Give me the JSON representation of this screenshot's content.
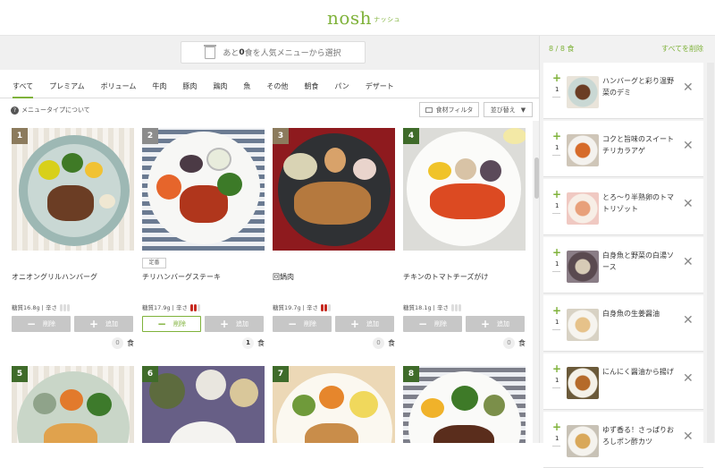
{
  "header": {
    "logo": "nosh",
    "logo_sub": "ナッシュ"
  },
  "search": {
    "prefix": "あと",
    "count": "0",
    "suffix": "食を人気メニューから選択"
  },
  "tabs": [
    "すべて",
    "プレミアム",
    "ボリューム",
    "牛肉",
    "豚肉",
    "鶏肉",
    "魚",
    "その他",
    "朝食",
    "パン",
    "デザート"
  ],
  "filter": {
    "type_info": "メニュータイプについて",
    "filter_btn": "食材フィルタ",
    "sort_btn": "並び替え"
  },
  "cards": [
    {
      "num": "1",
      "name": "オニオングリルハンバーグ",
      "badge": "",
      "carb": "糖質16.8g",
      "spicy_label": "辛さ",
      "minus": "削除",
      "plus": "追加",
      "qty": "0",
      "unit": "食"
    },
    {
      "num": "2",
      "name": "チリハンバーグステーキ",
      "badge": "定番",
      "carb": "糖質17.9g",
      "spicy_label": "辛さ",
      "minus": "削除",
      "plus": "追加",
      "qty": "1",
      "unit": "食"
    },
    {
      "num": "3",
      "name": "回鍋肉",
      "badge": "",
      "carb": "糖質19.7g",
      "spicy_label": "辛さ",
      "minus": "削除",
      "plus": "追加",
      "qty": "0",
      "unit": "食"
    },
    {
      "num": "4",
      "name": "チキンのトマトチーズがけ",
      "badge": "",
      "carb": "糖質18.1g",
      "spicy_label": "辛さ",
      "minus": "削除",
      "plus": "追加",
      "qty": "0",
      "unit": "食"
    },
    {
      "num": "5"
    },
    {
      "num": "6"
    },
    {
      "num": "7"
    },
    {
      "num": "8"
    }
  ],
  "sidebar": {
    "count": "8 / 8 食",
    "clear_all": "すべてを削除",
    "items": [
      {
        "qty": "1",
        "name": "ハンバーグと彩り温野菜のデミ"
      },
      {
        "qty": "1",
        "name": "コクと旨味のスイートチリカラアゲ"
      },
      {
        "qty": "1",
        "name": "とろ〜り半熟卵のトマトリゾット"
      },
      {
        "qty": "1",
        "name": "白身魚と野菜の白湯ソース"
      },
      {
        "qty": "1",
        "name": "白身魚の生姜醤油"
      },
      {
        "qty": "1",
        "name": "にんにく醤油から揚げ"
      },
      {
        "qty": "1",
        "name": "ゆず香る！さっぱりおろしポン酢カツ"
      }
    ]
  },
  "colors": {
    "accent": "#7fb23a",
    "tag_brown": "#8c7b5d",
    "tag_green": "#3f6b2a"
  }
}
